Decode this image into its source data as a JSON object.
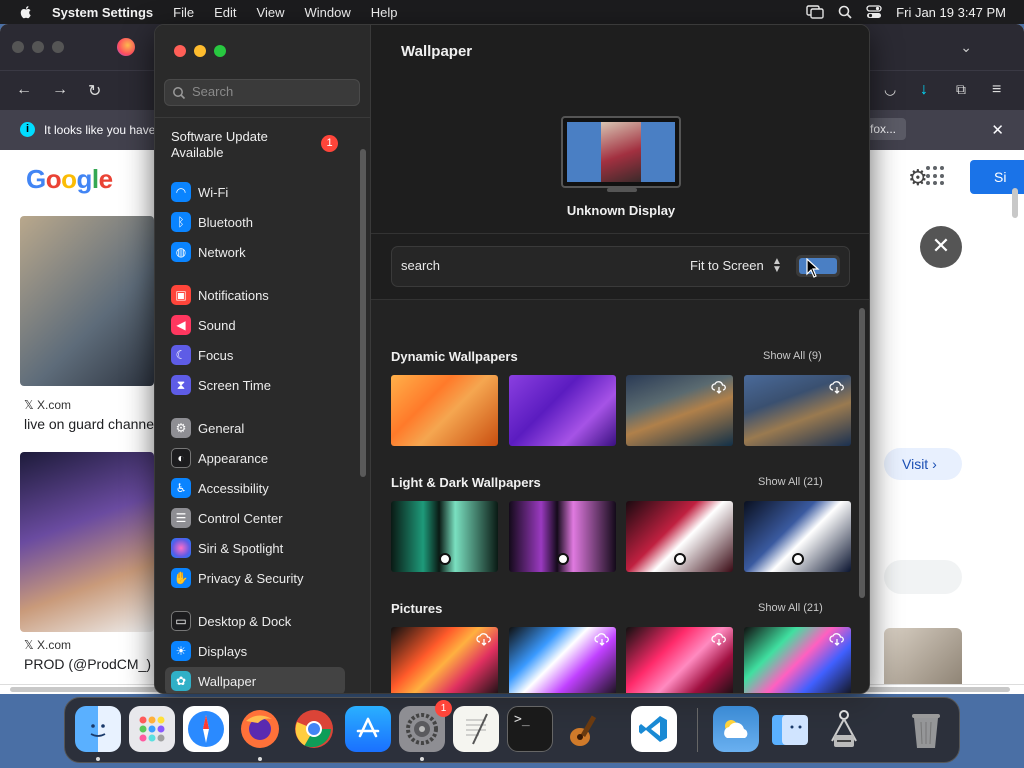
{
  "menubar": {
    "app_name": "System Settings",
    "menus": [
      "File",
      "Edit",
      "View",
      "Window",
      "Help"
    ],
    "datetime": "Fri Jan 19  3:47 PM",
    "icons": [
      "apple-icon",
      "screen-mirroring-icon",
      "spotlight-search-icon",
      "control-center-icon"
    ]
  },
  "browser": {
    "notification": "It looks like you have",
    "notification_tail": "fox...",
    "google_logo": "Google",
    "results": [
      {
        "source": "X.com",
        "caption": "live on guard channe"
      },
      {
        "source": "X.com",
        "caption": "PROD (@ProdCM_) /"
      }
    ],
    "signin_label": "Si",
    "visit_label": "Visit"
  },
  "sidebar": {
    "search_placeholder": "Search",
    "update": {
      "label_line1": "Software Update",
      "label_line2": "Available",
      "badge": "1"
    },
    "items": [
      {
        "label": "Wi-Fi",
        "icon": "wifi-icon",
        "color": "#0a84ff"
      },
      {
        "label": "Bluetooth",
        "icon": "bluetooth-icon",
        "color": "#0a84ff"
      },
      {
        "label": "Network",
        "icon": "globe-icon",
        "color": "#0a84ff"
      },
      {
        "label": "Notifications",
        "icon": "bell-icon",
        "color": "#ff453a"
      },
      {
        "label": "Sound",
        "icon": "speaker-icon",
        "color": "#ff375f"
      },
      {
        "label": "Focus",
        "icon": "moon-icon",
        "color": "#5e5ce6"
      },
      {
        "label": "Screen Time",
        "icon": "hourglass-icon",
        "color": "#5e5ce6"
      },
      {
        "label": "General",
        "icon": "gear-icon",
        "color": "#8e8e93"
      },
      {
        "label": "Appearance",
        "icon": "appearance-icon",
        "color": "#1c1c1e"
      },
      {
        "label": "Accessibility",
        "icon": "accessibility-icon",
        "color": "#0a84ff"
      },
      {
        "label": "Control Center",
        "icon": "toggles-icon",
        "color": "#8e8e93"
      },
      {
        "label": "Siri & Spotlight",
        "icon": "siri-icon",
        "color": "#bf5af2"
      },
      {
        "label": "Privacy & Security",
        "icon": "hand-icon",
        "color": "#0a84ff"
      },
      {
        "label": "Desktop & Dock",
        "icon": "dock-icon",
        "color": "#1c1c1e"
      },
      {
        "label": "Displays",
        "icon": "sun-icon",
        "color": "#0a84ff"
      },
      {
        "label": "Wallpaper",
        "icon": "flower-icon",
        "color": "#30b0c7"
      }
    ],
    "selected": "Wallpaper"
  },
  "wallpaper": {
    "title": "Wallpaper",
    "display_name": "Unknown Display",
    "search_value": "search",
    "fit_option": "Fit to Screen",
    "sections": [
      {
        "title": "Dynamic Wallpapers",
        "show_all": "Show All (9)"
      },
      {
        "title": "Light & Dark Wallpapers",
        "show_all": "Show All (21)"
      },
      {
        "title": "Pictures",
        "show_all": "Show All (21)"
      }
    ]
  },
  "dock": {
    "apps": [
      "Finder",
      "Launchpad",
      "Safari",
      "Firefox",
      "Chrome",
      "App Store",
      "System Settings",
      "TextEdit",
      "Terminal",
      "GarageBand",
      "Visual Studio Code",
      "Weather",
      "Migration Assistant",
      "Disk Utility",
      "Trash"
    ],
    "settings_badge": "1"
  },
  "colors": {
    "accent": "#0a84ff",
    "badge": "#ff453a",
    "window_bg": "#1e1e1e",
    "sidebar_bg": "#2a2a2a"
  }
}
